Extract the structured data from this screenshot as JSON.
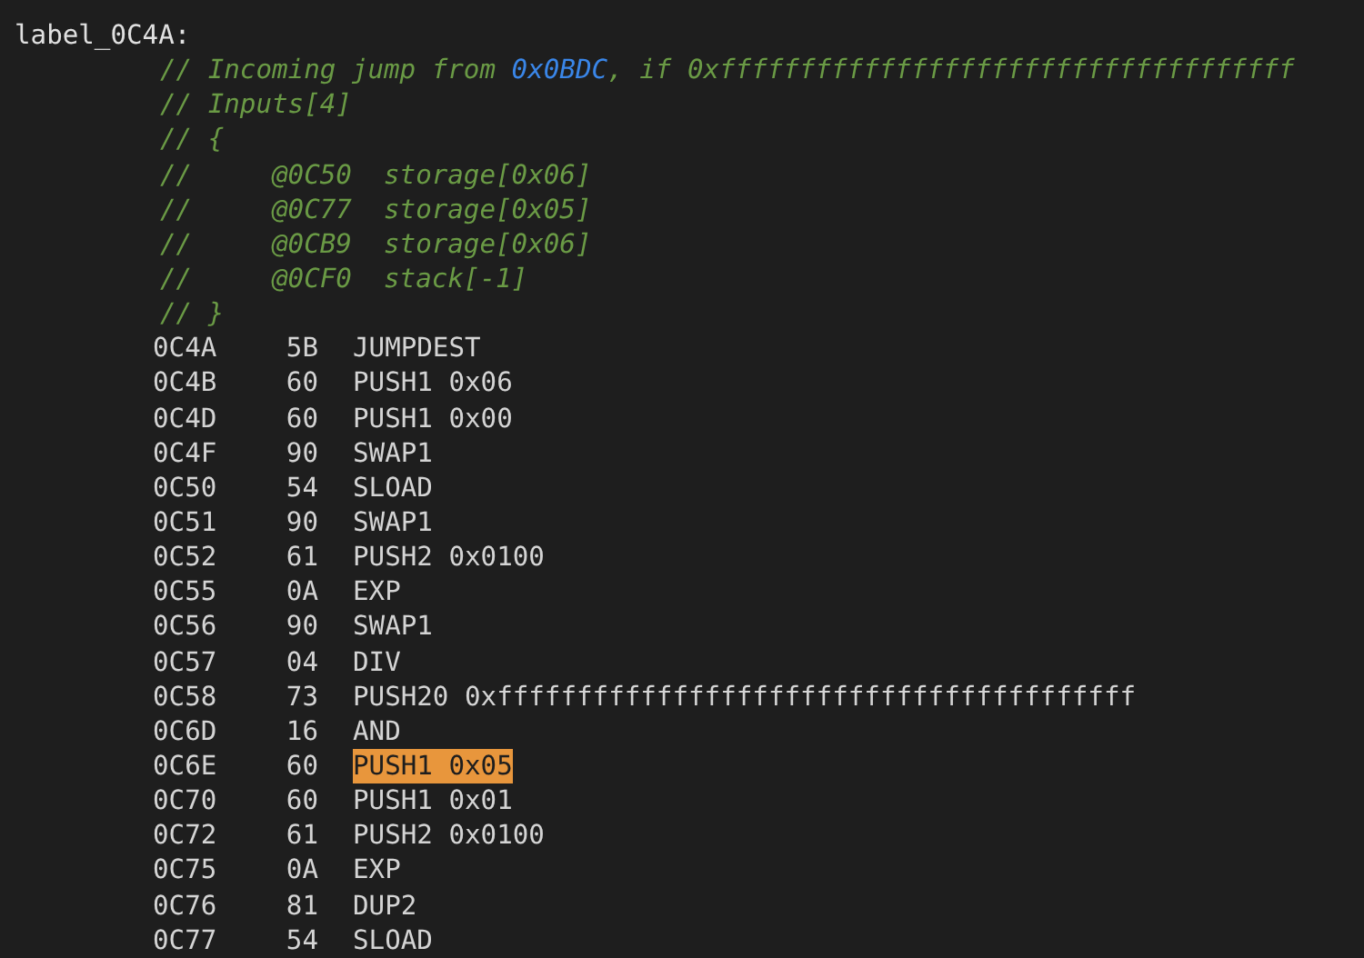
{
  "label": "label_0C4A:",
  "comments": [
    {
      "parts": [
        {
          "kind": "text",
          "text": "// Incoming jump from "
        },
        {
          "kind": "address",
          "text": "0x0BDC"
        },
        {
          "kind": "text",
          "text": ", if 0xffffffffffffffffffffffffffffffffffff"
        }
      ]
    },
    {
      "parts": [
        {
          "kind": "text",
          "text": "// Inputs[4]"
        }
      ]
    },
    {
      "parts": [
        {
          "kind": "text",
          "text": "// {"
        }
      ]
    },
    {
      "parts": [
        {
          "kind": "text",
          "text": "//     @0C50  storage[0x06]"
        }
      ]
    },
    {
      "parts": [
        {
          "kind": "text",
          "text": "//     @0C77  storage[0x05]"
        }
      ]
    },
    {
      "parts": [
        {
          "kind": "text",
          "text": "//     @0CB9  storage[0x06]"
        }
      ]
    },
    {
      "parts": [
        {
          "kind": "text",
          "text": "//     @0CF0  stack[-1]"
        }
      ]
    },
    {
      "parts": [
        {
          "kind": "text",
          "text": "// }"
        }
      ]
    }
  ],
  "instructions": [
    {
      "address": "0C4A",
      "byte": "5B",
      "op": "JUMPDEST",
      "selected": false
    },
    {
      "address": "0C4B",
      "byte": "60",
      "op": "PUSH1 0x06",
      "selected": false
    },
    {
      "address": "0C4D",
      "byte": "60",
      "op": "PUSH1 0x00",
      "selected": false
    },
    {
      "address": "0C4F",
      "byte": "90",
      "op": "SWAP1",
      "selected": false
    },
    {
      "address": "0C50",
      "byte": "54",
      "op": "SLOAD",
      "selected": false
    },
    {
      "address": "0C51",
      "byte": "90",
      "op": "SWAP1",
      "selected": false
    },
    {
      "address": "0C52",
      "byte": "61",
      "op": "PUSH2 0x0100",
      "selected": false
    },
    {
      "address": "0C55",
      "byte": "0A",
      "op": "EXP",
      "selected": false
    },
    {
      "address": "0C56",
      "byte": "90",
      "op": "SWAP1",
      "selected": false
    },
    {
      "address": "0C57",
      "byte": "04",
      "op": "DIV",
      "selected": false
    },
    {
      "address": "0C58",
      "byte": "73",
      "op": "PUSH20 0xffffffffffffffffffffffffffffffffffffffff",
      "selected": false
    },
    {
      "address": "0C6D",
      "byte": "16",
      "op": "AND",
      "selected": false
    },
    {
      "address": "0C6E",
      "byte": "60",
      "op": "PUSH1 0x05",
      "selected": true
    },
    {
      "address": "0C70",
      "byte": "60",
      "op": "PUSH1 0x01",
      "selected": false
    },
    {
      "address": "0C72",
      "byte": "61",
      "op": "PUSH2 0x0100",
      "selected": false
    },
    {
      "address": "0C75",
      "byte": "0A",
      "op": "EXP",
      "selected": false
    },
    {
      "address": "0C76",
      "byte": "81",
      "op": "DUP2",
      "selected": false
    },
    {
      "address": "0C77",
      "byte": "54",
      "op": "SLOAD",
      "selected": false
    }
  ]
}
